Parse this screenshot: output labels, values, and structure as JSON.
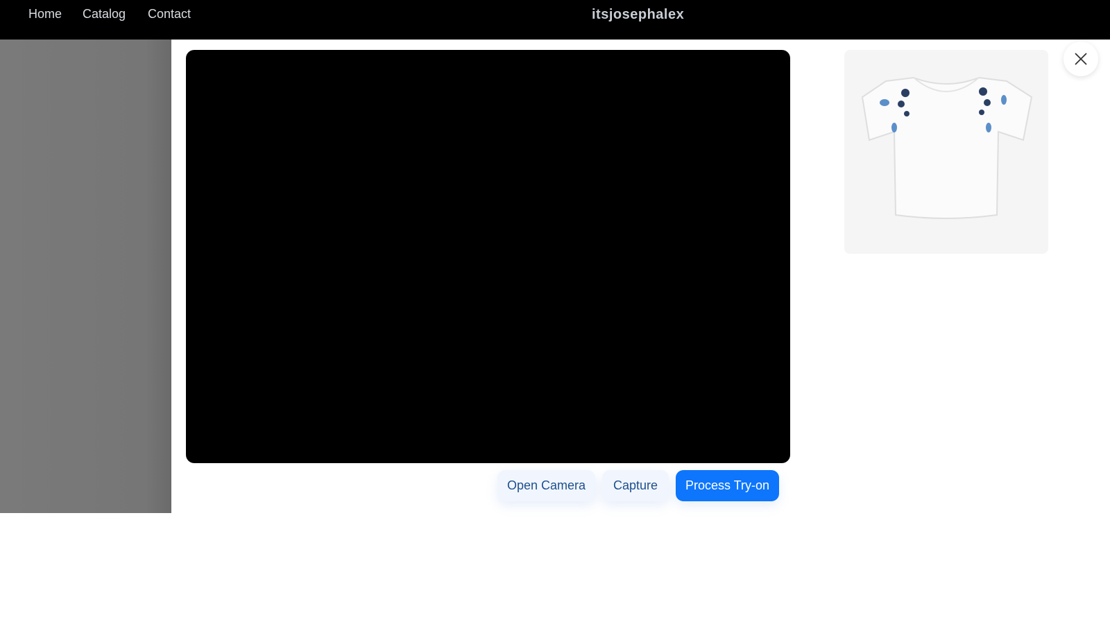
{
  "nav": {
    "links": [
      {
        "label": "Home"
      },
      {
        "label": "Catalog"
      },
      {
        "label": "Contact"
      }
    ],
    "brand": "itsjosephalex"
  },
  "modal": {
    "buttons": {
      "open_camera": "Open Camera",
      "capture": "Capture",
      "process": "Process Try-on"
    },
    "product_image": "white embroidered blouse",
    "close_icon": "close-icon",
    "colors": {
      "primary": "#0d76fc",
      "light_button": "#f1f6fe",
      "video_bg": "#000000"
    }
  }
}
